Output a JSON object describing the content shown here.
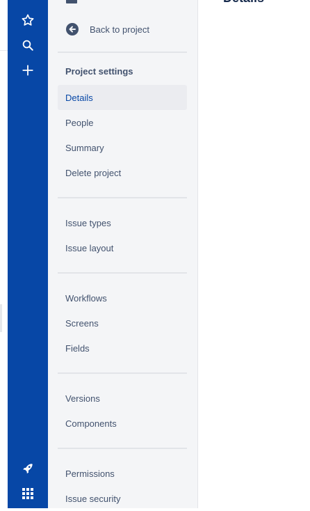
{
  "content": {
    "title": "Details"
  },
  "sidebar": {
    "back_label": "Back to project",
    "group_title": "Project settings",
    "items": [
      {
        "label": "Details",
        "active": true
      },
      {
        "label": "People"
      },
      {
        "label": "Summary"
      },
      {
        "label": "Delete project"
      },
      {
        "label": "Issue types"
      },
      {
        "label": "Issue layout"
      },
      {
        "label": "Workflows"
      },
      {
        "label": "Screens"
      },
      {
        "label": "Fields"
      },
      {
        "label": "Versions"
      },
      {
        "label": "Components"
      },
      {
        "label": "Permissions"
      },
      {
        "label": "Issue security"
      }
    ]
  },
  "global_nav": {
    "icons": [
      "star-icon",
      "search-icon",
      "plus-icon",
      "rocket-icon",
      "app-grid-icon"
    ]
  },
  "colors": {
    "nav_bg": "#0747a6",
    "sidebar_bg": "#f4f5f7",
    "active_bg": "#ebecf0",
    "text": "#42526e",
    "active_text": "#0747a6"
  }
}
